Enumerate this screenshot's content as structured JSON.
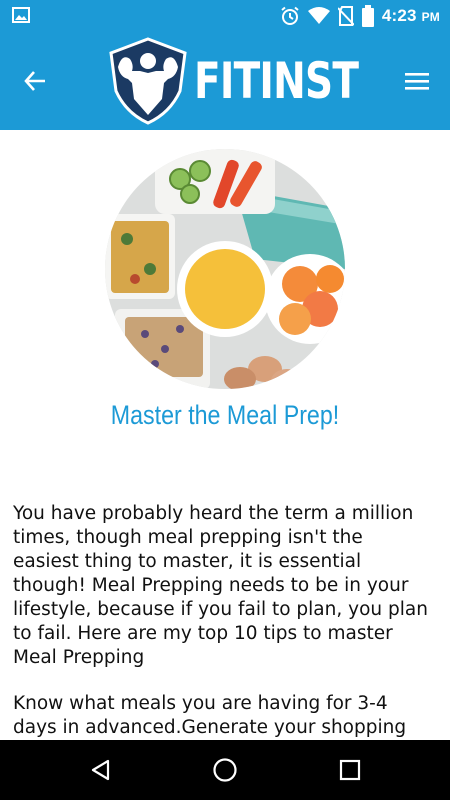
{
  "status_bar": {
    "time": "4:23",
    "ampm": "PM",
    "icons": [
      "image-notification-icon",
      "alarm-icon",
      "wifi-icon",
      "no-sim-icon",
      "battery-icon"
    ]
  },
  "app_bar": {
    "logo_text": "FITINST",
    "brand_color": "#1c9ad6",
    "back_icon": "arrow-left-icon",
    "menu_icon": "hamburger-menu-icon"
  },
  "article": {
    "hero_image": "meal-prep-food-bowls",
    "title": "Master the Meal Prep!",
    "paragraphs": [
      "You have probably heard the term a million times, though meal prepping isn't the easiest thing to master, it is essential though! Meal Prepping needs to be in your lifestyle, because if you fail to plan, you plan to fail. Here are my top 10 tips to master Meal Prepping",
      "Know what meals you are having for 3-4 days in advanced.Generate your shopping list and"
    ]
  },
  "nav_bar": {
    "icons": [
      "back-triangle-icon",
      "home-circle-icon",
      "recents-square-icon"
    ]
  }
}
